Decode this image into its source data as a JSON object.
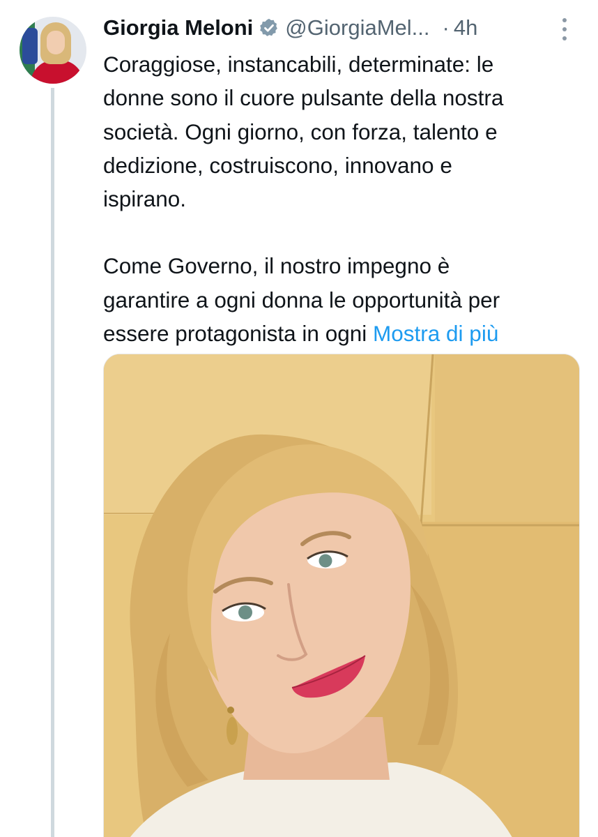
{
  "tweet": {
    "author_name": "Giorgia Meloni",
    "handle": "@GiorgiaMel...",
    "separator": "·",
    "time": "4h",
    "verified": true,
    "text_line_1": "Coraggiose, instancabili, determinate: le",
    "text_line_2": "donne sono il cuore pulsante della nostra",
    "text_line_3": "società. Ogni giorno, con forza, talento e",
    "text_line_4": "dedizione, costruiscono, innovano e",
    "text_line_5": "ispirano.",
    "text_line_6": "Come Governo, il nostro impegno è",
    "text_line_7": "garantire a ogni donna le opportunità per",
    "text_line_8": "essere protagonista in ogni",
    "show_more": "Mostra di più"
  },
  "icons": {
    "verified": "verified-badge-icon",
    "more": "more-options-icon"
  },
  "colors": {
    "link": "#1d9bf0",
    "secondary_text": "#536471",
    "thread_line": "#cfd9de",
    "verified_badge": "#829aab"
  }
}
